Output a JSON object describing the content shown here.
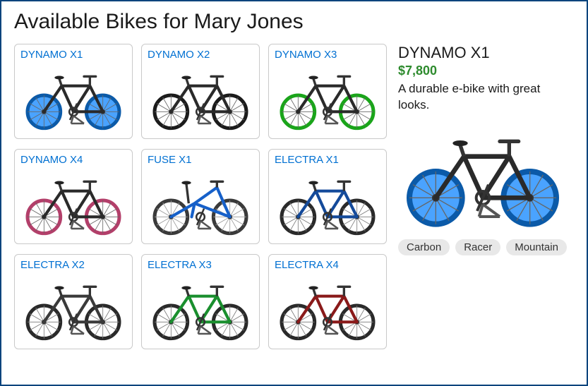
{
  "title": "Available Bikes for Mary Jones",
  "bikes": [
    {
      "name": "DYNAMO X1",
      "frame": "#2a2a2a",
      "wheelFill": "#4aa3ff",
      "wheelStroke": "#0b5aa8",
      "spokes": "#666"
    },
    {
      "name": "DYNAMO X2",
      "frame": "#2a2a2a",
      "wheelFill": "none",
      "wheelStroke": "#1b1b1b",
      "spokes": "#666"
    },
    {
      "name": "DYNAMO X3",
      "frame": "#2a2a2a",
      "wheelFill": "none",
      "wheelStroke": "#1aa51a",
      "spokes": "#666"
    },
    {
      "name": "DYNAMO X4",
      "frame": "#2a2a2a",
      "wheelFill": "none",
      "wheelStroke": "#b33f6a",
      "spokes": "#666"
    },
    {
      "name": "FUSE X1",
      "frame": "#1660c9",
      "wheelFill": "none",
      "wheelStroke": "#3a3a3a",
      "spokes": "#9a9a9a",
      "type": "city"
    },
    {
      "name": "ELECTRA X1",
      "frame": "#144a9a",
      "wheelFill": "none",
      "wheelStroke": "#2a2a2a",
      "spokes": "#7a7a7a"
    },
    {
      "name": "ELECTRA X2",
      "frame": "#3a3a3a",
      "wheelFill": "none",
      "wheelStroke": "#2a2a2a",
      "spokes": "#7a7a7a"
    },
    {
      "name": "ELECTRA X3",
      "frame": "#1a8f2e",
      "wheelFill": "none",
      "wheelStroke": "#2a2a2a",
      "spokes": "#7a7a7a"
    },
    {
      "name": "ELECTRA X4",
      "frame": "#8a1a1a",
      "wheelFill": "none",
      "wheelStroke": "#2a2a2a",
      "spokes": "#7a7a7a"
    }
  ],
  "detail": {
    "name": "DYNAMO X1",
    "price": "$7,800",
    "description": "A durable e-bike with great looks.",
    "frame": "#2a2a2a",
    "wheelFill": "#4aa3ff",
    "wheelStroke": "#0b5aa8",
    "spokes": "#666",
    "tags": [
      "Carbon",
      "Racer",
      "Mountain"
    ]
  }
}
